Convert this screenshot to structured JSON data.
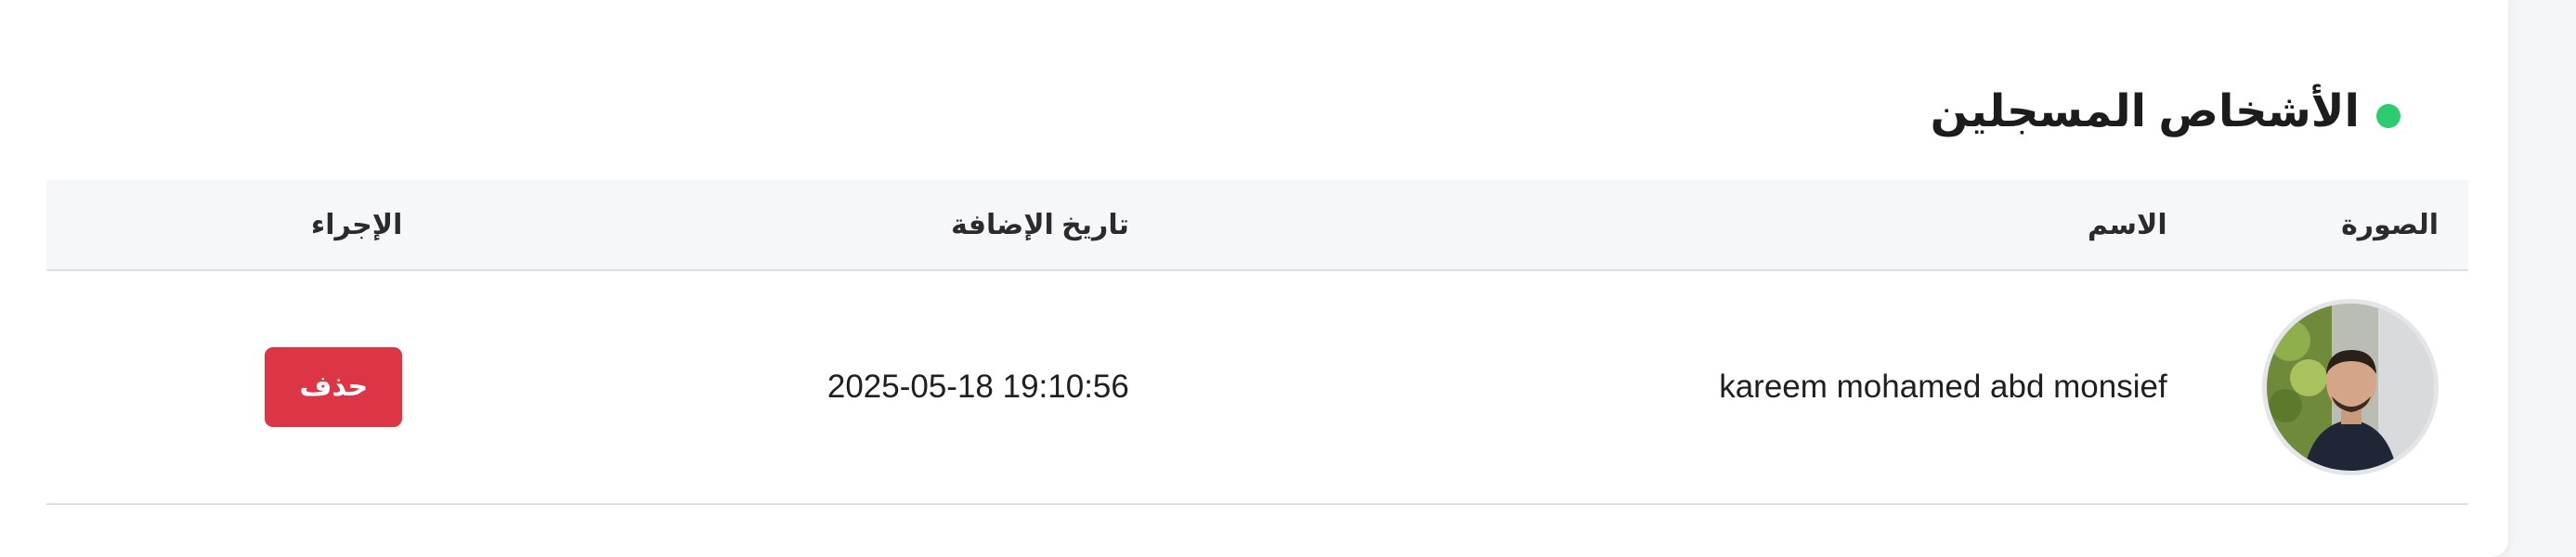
{
  "section": {
    "title": "الأشخاص المسجلين",
    "status_color": "#2ecc71"
  },
  "table": {
    "headers": {
      "photo": "الصورة",
      "name": "الاسم",
      "date_added": "تاريخ الإضافة",
      "action": "الإجراء"
    },
    "rows": [
      {
        "name": "kareem mohamed abd monsief",
        "date_added": "2025-05-18 19:10:56",
        "action_label": "حذف"
      }
    ]
  },
  "colors": {
    "delete_button": "#dc3545",
    "header_bg": "#f6f7f9"
  },
  "icons": {
    "avatar": "person-photo"
  }
}
